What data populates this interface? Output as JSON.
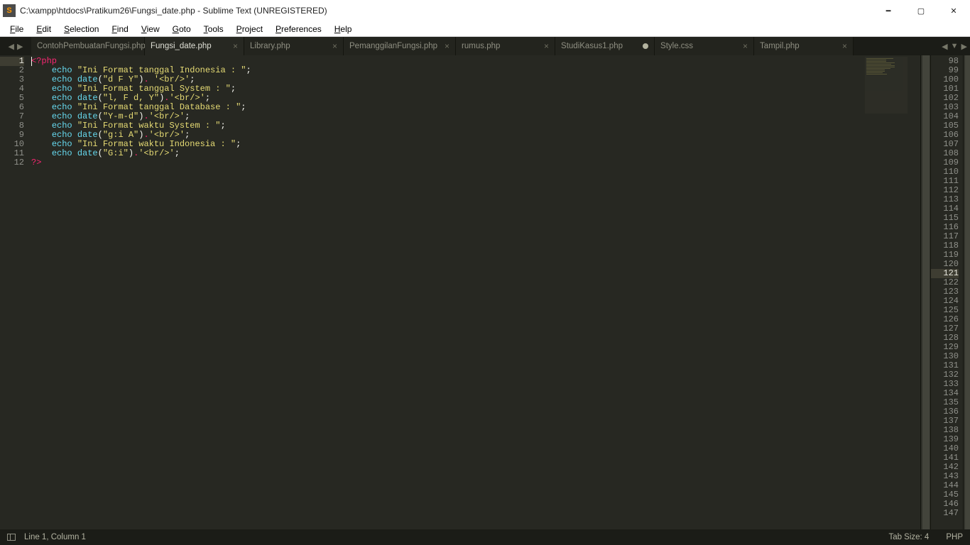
{
  "window": {
    "title": "C:\\xampp\\htdocs\\Pratikum26\\Fungsi_date.php - Sublime Text (UNREGISTERED)",
    "icon_letter": "S"
  },
  "menu": [
    "File",
    "Edit",
    "Selection",
    "Find",
    "View",
    "Goto",
    "Tools",
    "Project",
    "Preferences",
    "Help"
  ],
  "tabs": [
    {
      "label": "ContohPembuatanFungsi.php",
      "active": false,
      "dirty": false
    },
    {
      "label": "Fungsi_date.php",
      "active": true,
      "dirty": false
    },
    {
      "label": "Library.php",
      "active": false,
      "dirty": false
    },
    {
      "label": "PemanggilanFungsi.php",
      "active": false,
      "dirty": false
    },
    {
      "label": "rumus.php",
      "active": false,
      "dirty": false
    },
    {
      "label": "StudiKasus1.php",
      "active": false,
      "dirty": true
    },
    {
      "label": "Style.css",
      "active": false,
      "dirty": false
    },
    {
      "label": "Tampil.php",
      "active": false,
      "dirty": false
    }
  ],
  "left_lines_start": 1,
  "left_lines_end": 12,
  "left_current_line": 1,
  "right_lines_start": 98,
  "right_lines_end": 147,
  "right_highlight": 121,
  "code_lines": [
    [
      [
        "tag",
        "<?php"
      ]
    ],
    [
      [
        "ind",
        "    "
      ],
      [
        "kw",
        "echo "
      ],
      [
        "str",
        "\"Ini Format tanggal Indonesia : \""
      ],
      [
        "pun",
        ";"
      ]
    ],
    [
      [
        "ind",
        "    "
      ],
      [
        "kw",
        "echo "
      ],
      [
        "func",
        "date"
      ],
      [
        "pun",
        "("
      ],
      [
        "str",
        "\"d F Y\""
      ],
      [
        "pun",
        ")"
      ],
      [
        "op",
        ". "
      ],
      [
        "str",
        "'<br/>'"
      ],
      [
        "pun",
        ";"
      ]
    ],
    [
      [
        "ind",
        "    "
      ],
      [
        "kw",
        "echo "
      ],
      [
        "str",
        "\"Ini Format tanggal System : \""
      ],
      [
        "pun",
        ";"
      ]
    ],
    [
      [
        "ind",
        "    "
      ],
      [
        "kw",
        "echo "
      ],
      [
        "func",
        "date"
      ],
      [
        "pun",
        "("
      ],
      [
        "str",
        "\"l, F d, Y\""
      ],
      [
        "pun",
        ")"
      ],
      [
        "op",
        "."
      ],
      [
        "str",
        "'<br/>'"
      ],
      [
        "pun",
        ";"
      ]
    ],
    [
      [
        "ind",
        "    "
      ],
      [
        "kw",
        "echo "
      ],
      [
        "str",
        "\"Ini Format tanggal Database : \""
      ],
      [
        "pun",
        ";"
      ]
    ],
    [
      [
        "ind",
        "    "
      ],
      [
        "kw",
        "echo "
      ],
      [
        "func",
        "date"
      ],
      [
        "pun",
        "("
      ],
      [
        "str",
        "\"Y-m-d\""
      ],
      [
        "pun",
        ")"
      ],
      [
        "op",
        "."
      ],
      [
        "str",
        "'<br/>'"
      ],
      [
        "pun",
        ";"
      ]
    ],
    [
      [
        "ind",
        "    "
      ],
      [
        "kw",
        "echo "
      ],
      [
        "str",
        "\"Ini Format waktu System : \""
      ],
      [
        "pun",
        ";"
      ]
    ],
    [
      [
        "ind",
        "    "
      ],
      [
        "kw",
        "echo "
      ],
      [
        "func",
        "date"
      ],
      [
        "pun",
        "("
      ],
      [
        "str",
        "\"g:i A\""
      ],
      [
        "pun",
        ")"
      ],
      [
        "op",
        "."
      ],
      [
        "str",
        "'<br/>'"
      ],
      [
        "pun",
        ";"
      ]
    ],
    [
      [
        "ind",
        "    "
      ],
      [
        "kw",
        "echo "
      ],
      [
        "str",
        "\"Ini Format waktu Indonesia : \""
      ],
      [
        "pun",
        ";"
      ]
    ],
    [
      [
        "ind",
        "    "
      ],
      [
        "kw",
        "echo "
      ],
      [
        "func",
        "date"
      ],
      [
        "pun",
        "("
      ],
      [
        "str",
        "\"G:i\""
      ],
      [
        "pun",
        ")"
      ],
      [
        "op",
        "."
      ],
      [
        "str",
        "'<br/>'"
      ],
      [
        "pun",
        ";"
      ]
    ],
    [
      [
        "tag",
        "?>"
      ]
    ]
  ],
  "statusbar": {
    "position": "Line 1, Column 1",
    "tabsize": "Tab Size: 4",
    "syntax": "PHP"
  }
}
